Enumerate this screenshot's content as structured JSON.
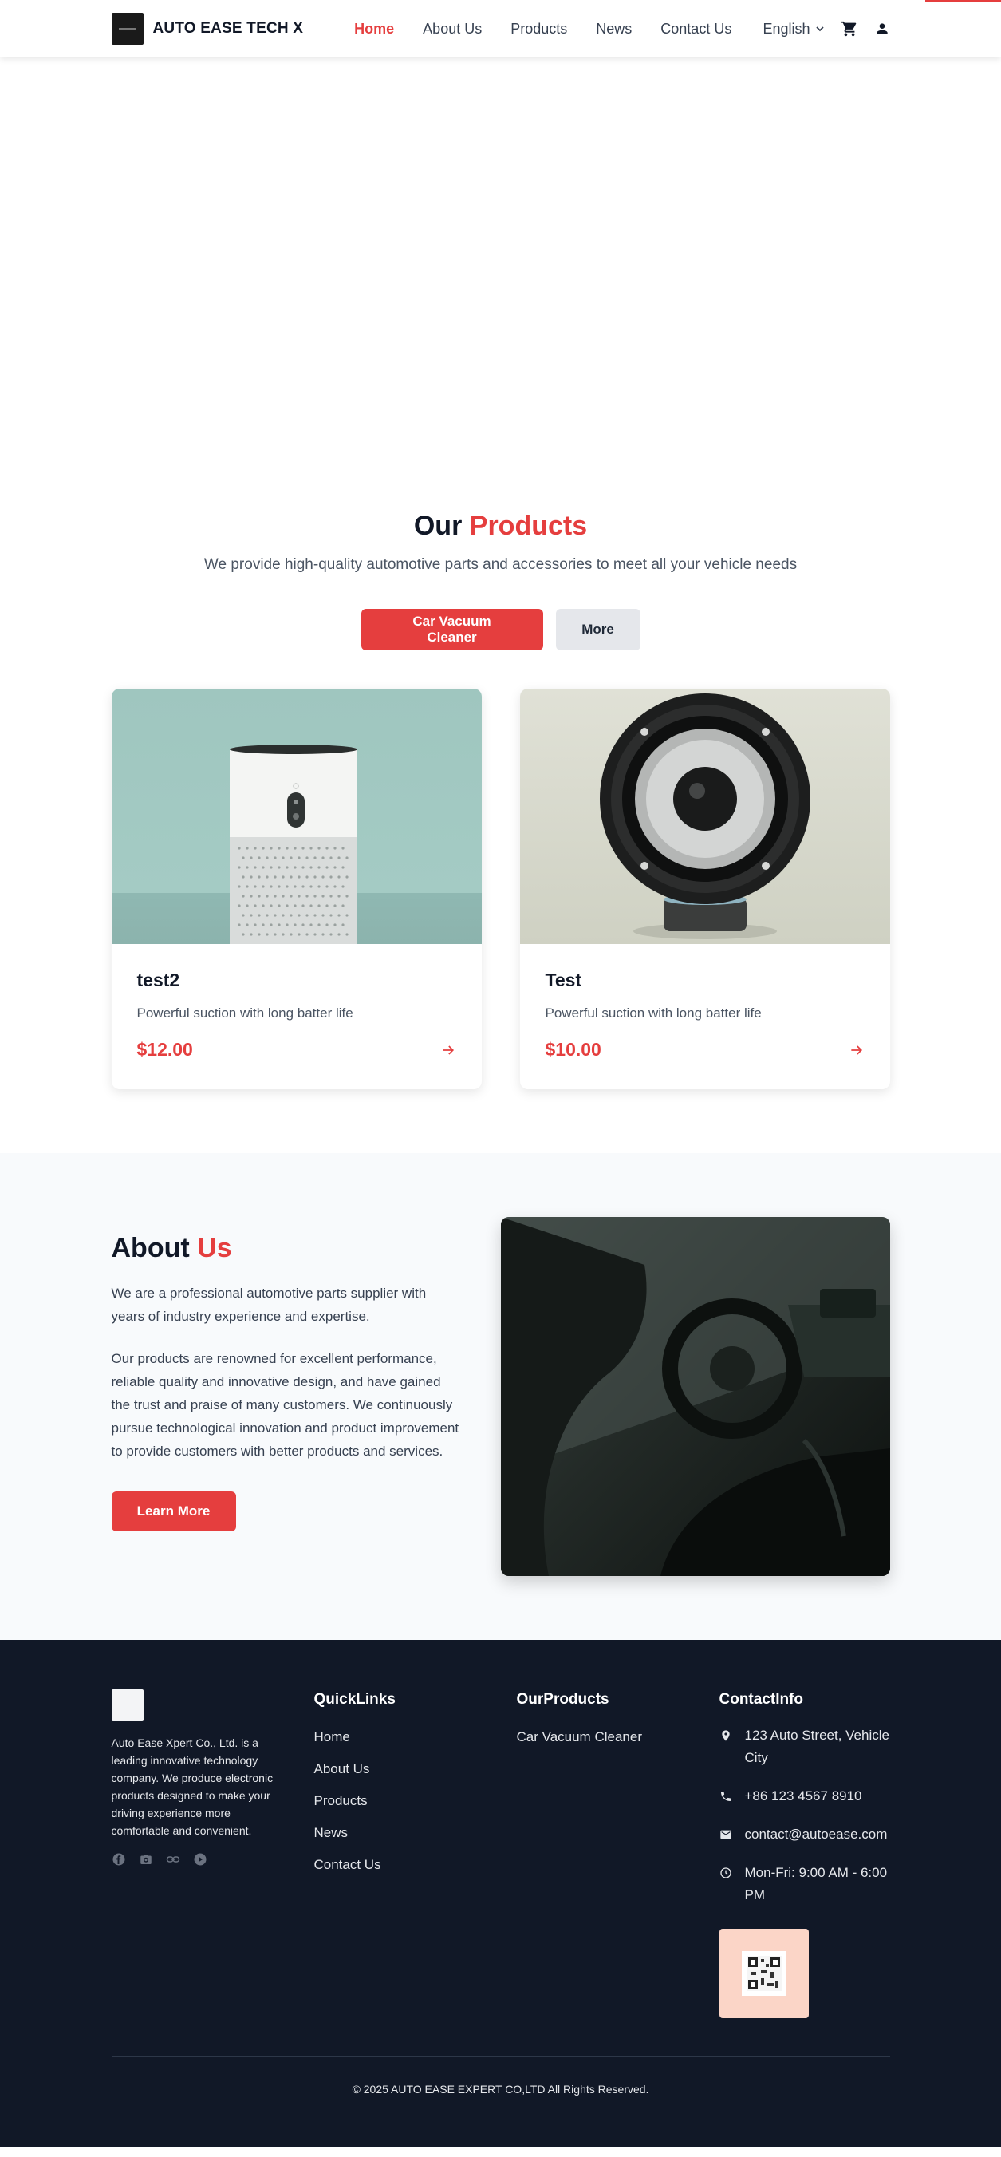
{
  "header": {
    "brand": "AUTO EASE TECH X",
    "nav": [
      "Home",
      "About Us",
      "Products",
      "News",
      "Contact Us"
    ],
    "active_nav": "Home",
    "language": "English"
  },
  "products": {
    "title_main": "Our",
    "title_accent": "Products",
    "subtitle": "We provide high-quality automotive parts and accessories to meet all your vehicle needs",
    "tabs": [
      "Car Vacuum Cleaner",
      "More"
    ],
    "items": [
      {
        "name": "test2",
        "description": "Powerful suction with long batter life",
        "price": "$12.00"
      },
      {
        "name": "Test",
        "description": "Powerful suction with long batter life",
        "price": "$10.00"
      }
    ]
  },
  "about": {
    "title_main": "About",
    "title_accent": "Us",
    "p1": "We are a professional automotive parts supplier with years of industry experience and expertise.",
    "p2": "Our products are renowned for excellent performance, reliable quality and innovative design, and have gained the trust and praise of many customers. We continuously pursue technological innovation and product improvement to provide customers with better products and services.",
    "button": "Learn More"
  },
  "footer": {
    "about_text": "Auto Ease Xpert Co., Ltd. is a leading innovative technology company. We produce electronic products designed to make your driving experience more comfortable and convenient.",
    "social_icons": [
      "facebook-icon",
      "camera-icon",
      "link-icon",
      "play-icon"
    ],
    "quicklinks_title": "QuickLinks",
    "quicklinks": [
      "Home",
      "About Us",
      "Products",
      "News",
      "Contact Us"
    ],
    "products_title": "OurProducts",
    "products": [
      "Car Vacuum Cleaner"
    ],
    "contact_title": "ContactInfo",
    "address": "123 Auto Street, Vehicle City",
    "phone": "+86 123 4567 8910",
    "email": "contact@autoease.com",
    "hours": "Mon-Fri: 9:00 AM - 6:00 PM",
    "copyright": "© 2025 AUTO EASE EXPERT CO,LTD All Rights Reserved."
  },
  "colors": {
    "accent": "#e53e3e",
    "footer_bg": "#111827",
    "about_bg": "#f8fafc"
  }
}
